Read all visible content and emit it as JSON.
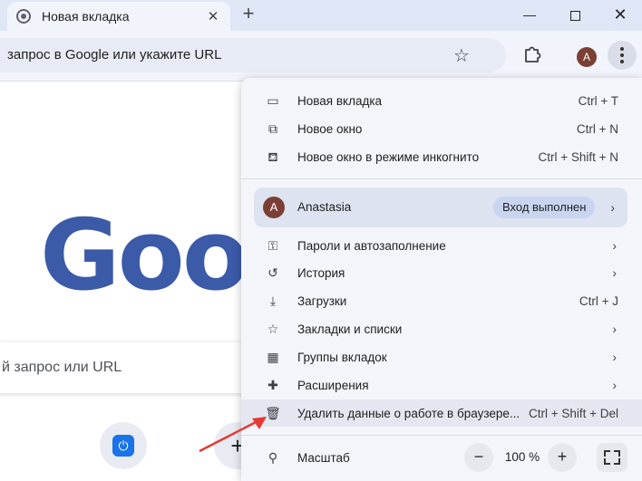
{
  "tab": {
    "title": "Новая вкладка",
    "close": "✕"
  },
  "newtab": "+",
  "window": {
    "minimize": "—",
    "close": "✕"
  },
  "omnibox": {
    "text": "запрос в Google или укажите URL"
  },
  "toolbar": {
    "avatar_letter": "A",
    "bookmark_star": "☆"
  },
  "page": {
    "logo_text": "Goog",
    "search_placeholder": "й запрос или URL",
    "add_shortcut": "+",
    "shortcut_glyph": "⏻"
  },
  "menu": {
    "items_top": [
      {
        "icon": "▭",
        "label": "Новая вкладка",
        "shortcut": "Ctrl + T"
      },
      {
        "icon": "⧉",
        "label": "Новое окно",
        "shortcut": "Ctrl + N"
      },
      {
        "icon": "⛾",
        "label": "Новое окно в режиме инкогнито",
        "shortcut": "Ctrl + Shift + N"
      }
    ],
    "profile": {
      "letter": "A",
      "name": "Anastasia",
      "status": "Вход выполнен",
      "chev": "›"
    },
    "items_mid": [
      {
        "icon": "⚿",
        "label": "Пароли и автозаполнение",
        "chev": "›"
      },
      {
        "icon": "↺",
        "label": "История",
        "chev": "›"
      },
      {
        "icon": "⤓",
        "label": "Загрузки",
        "shortcut": "Ctrl + J"
      },
      {
        "icon": "☆",
        "label": "Закладки и списки",
        "chev": "›"
      },
      {
        "icon": "▦",
        "label": "Группы вкладок",
        "chev": "›"
      },
      {
        "icon": "✚",
        "label": "Расширения",
        "chev": "›"
      },
      {
        "icon": "🗑",
        "label": "Удалить данные о работе в браузере...",
        "shortcut": "Ctrl + Shift + Del"
      }
    ],
    "zoom": {
      "icon": "⚲",
      "label": "Масштаб",
      "minus": "−",
      "value": "100 %",
      "plus": "+"
    }
  },
  "colors": {
    "accent_arrow": "#e53935",
    "logo": "#3b5aa8"
  }
}
